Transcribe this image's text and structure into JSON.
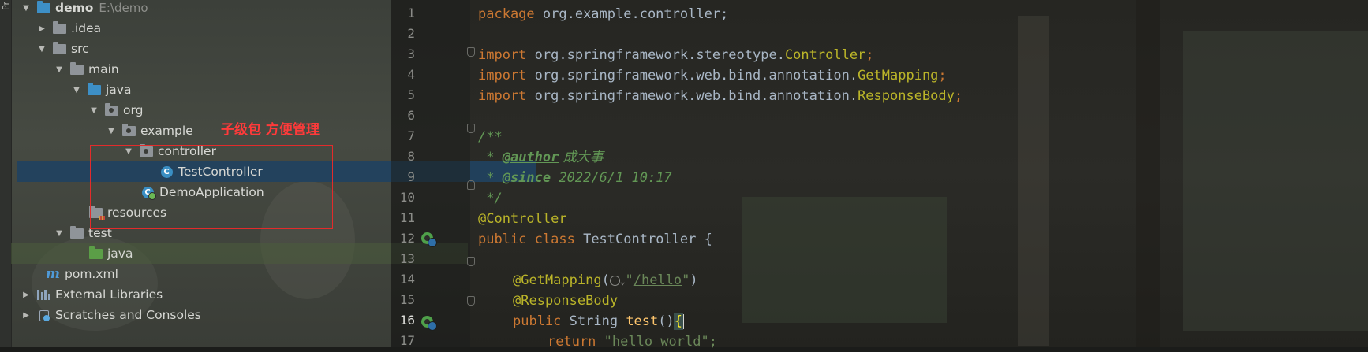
{
  "stripe": {
    "label": "Pr"
  },
  "tree": {
    "root": {
      "label": "demo",
      "path": "E:\\demo"
    },
    "items": [
      {
        "label": ".idea"
      },
      {
        "label": "src"
      },
      {
        "label": "main"
      },
      {
        "label": "java"
      },
      {
        "label": "org"
      },
      {
        "label": "example"
      },
      {
        "label": "controller"
      },
      {
        "label": "TestController",
        "selected": true
      },
      {
        "label": "DemoApplication"
      },
      {
        "label": "resources"
      },
      {
        "label": "test"
      },
      {
        "label": "java"
      },
      {
        "label": "pom.xml"
      },
      {
        "label": "External Libraries"
      },
      {
        "label": "Scratches and Consoles"
      }
    ]
  },
  "annotation": {
    "text": "子级包 方便管理",
    "color": "#ff3a3a"
  },
  "editor": {
    "line_numbers": [
      "1",
      "2",
      "3",
      "4",
      "5",
      "6",
      "7",
      "8",
      "9",
      "10",
      "11",
      "12",
      "13",
      "14",
      "15",
      "16",
      "17"
    ],
    "current_line": "16",
    "lines": {
      "l1": {
        "kw": "package",
        "rest": " org.example.controller;"
      },
      "l3": {
        "kw": "import",
        "pkg": " org.springframework.stereotype.",
        "cls": "Controller",
        "end": ";"
      },
      "l4": {
        "kw": "import",
        "pkg": " org.springframework.web.bind.annotation.",
        "cls": "GetMapping",
        "end": ";"
      },
      "l5": {
        "kw": "import",
        "pkg": " org.springframework.web.bind.annotation.",
        "cls": "ResponseBody",
        "end": ";"
      },
      "l7": {
        "text": "/**"
      },
      "l8": {
        "star": " * ",
        "tag": "@author",
        "value": " 成大事"
      },
      "l9": {
        "star": " * ",
        "tag": "@since",
        "value": " 2022/6/1 10:17"
      },
      "l10": {
        "text": " */"
      },
      "l11": {
        "ann": "@Controller"
      },
      "l12": {
        "kw1": "public",
        "kw2": " class",
        "rest": " TestController {"
      },
      "l14": {
        "ann": "@GetMapping",
        "open": "(",
        "str_open": "\"",
        "url": "/hello",
        "str_close": "\"",
        "close": ")"
      },
      "l15": {
        "ann": "@ResponseBody"
      },
      "l16": {
        "kw": "public",
        "type": " String",
        "fn": " test",
        "parens": "()",
        "brace": "{"
      },
      "l17": {
        "kw": "return",
        "str": " \"hello world\";"
      }
    }
  },
  "colors": {
    "keyword": "#cc7832",
    "annotation": "#bbb529",
    "comment": "#629755",
    "string": "#6a8759",
    "function": "#ffc66d",
    "selection": "#214260"
  }
}
